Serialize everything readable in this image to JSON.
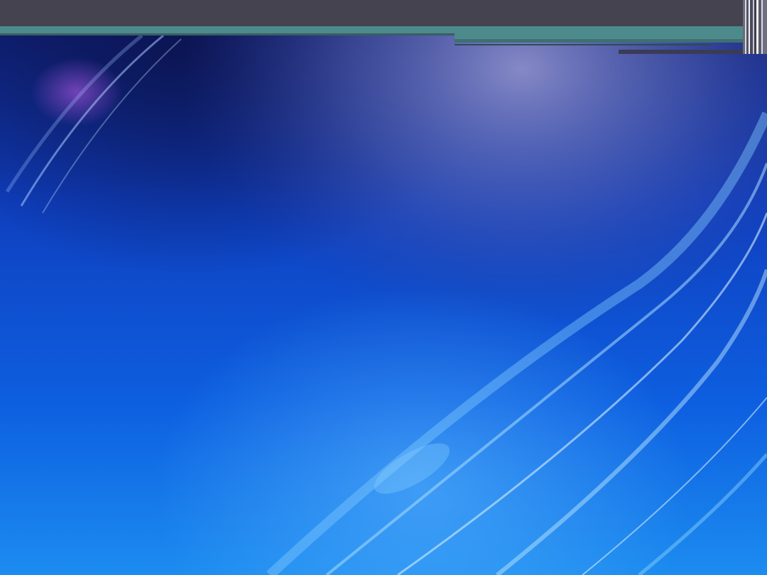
{
  "slide": {
    "title": "",
    "body": ""
  },
  "theme": {
    "title_band_color": "#44434f",
    "accent_color": "#4c8a8b",
    "background_color": "#0b3fc9"
  }
}
